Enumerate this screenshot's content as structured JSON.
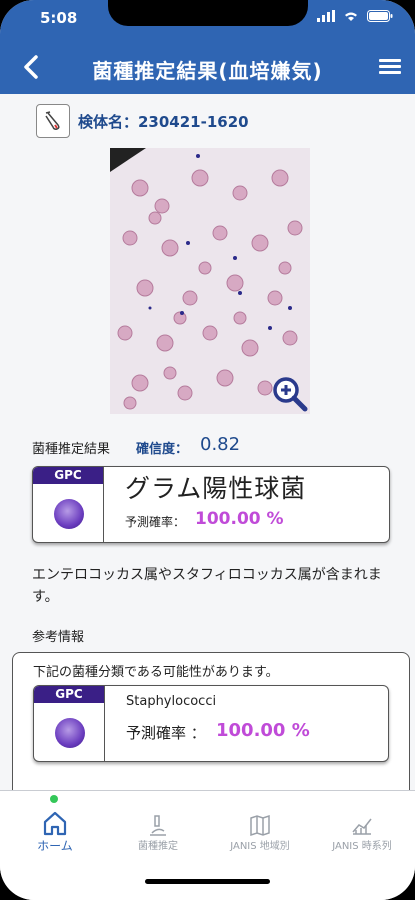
{
  "status": {
    "time": "5:08"
  },
  "nav": {
    "title": "菌種推定結果(血培嫌気)"
  },
  "specimen": {
    "label": "検体名：230421-1620"
  },
  "result": {
    "heading": "菌種推定結果",
    "confidence_label": "確信度：",
    "confidence_value": "0.82",
    "badge": "GPC",
    "species": "グラム陽性球菌",
    "prob_label": "予測確率：",
    "prob_value": "100.00 %",
    "description": "エンテロコッカス属やスタフィロコッカス属が含まれます。"
  },
  "reference": {
    "title": "参考情報",
    "intro": "下記の菌種分類である可能性があります。",
    "badge": "GPC",
    "species": "Staphylococci",
    "prob_label": "予測確率 ：",
    "prob_value": "100.00 %"
  },
  "tabs": [
    {
      "label": "ホーム",
      "icon": "home-icon",
      "active": true
    },
    {
      "label": "菌種推定",
      "icon": "microscope-icon",
      "active": false
    },
    {
      "label": "JANIS 地域別",
      "icon": "map-icon",
      "active": false
    },
    {
      "label": "JANIS 時系列",
      "icon": "chart-icon",
      "active": false
    }
  ]
}
